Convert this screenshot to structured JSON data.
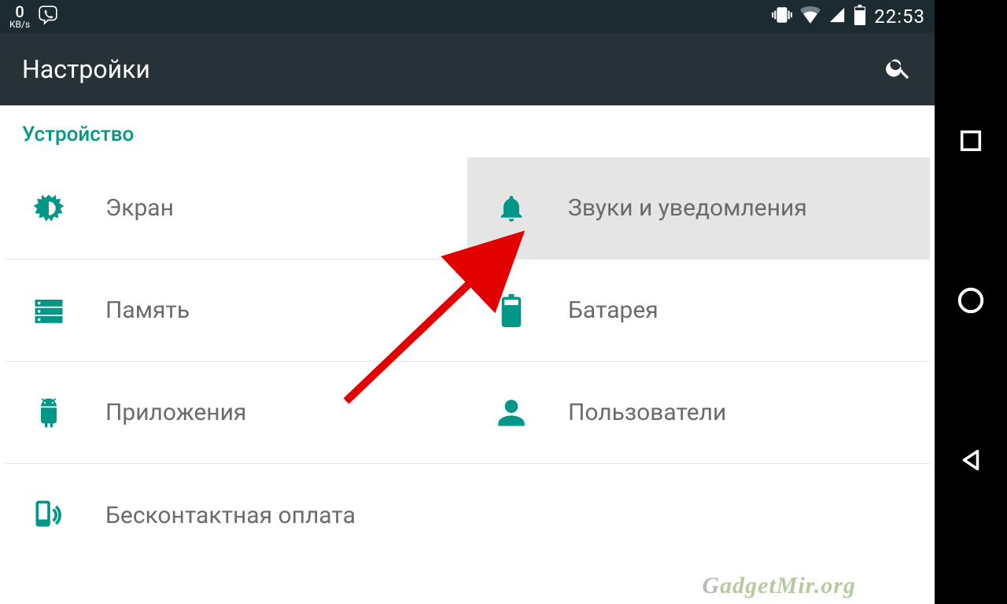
{
  "statusbar": {
    "speed_value": "0",
    "speed_unit": "KB/s",
    "clock": "22:53"
  },
  "appbar": {
    "title": "Настройки"
  },
  "section": {
    "header": "Устройство"
  },
  "items": {
    "display": "Экран",
    "sound": "Звуки и уведомления",
    "storage": "Память",
    "battery": "Батарея",
    "apps": "Приложения",
    "users": "Пользователи",
    "nfc": "Бесконтактная оплата"
  },
  "watermark": "GadgetMir.org",
  "colors": {
    "accent": "#009688",
    "appbar": "#263238",
    "statusbar": "#1c2b32",
    "highlight": "#e5e5e5"
  }
}
